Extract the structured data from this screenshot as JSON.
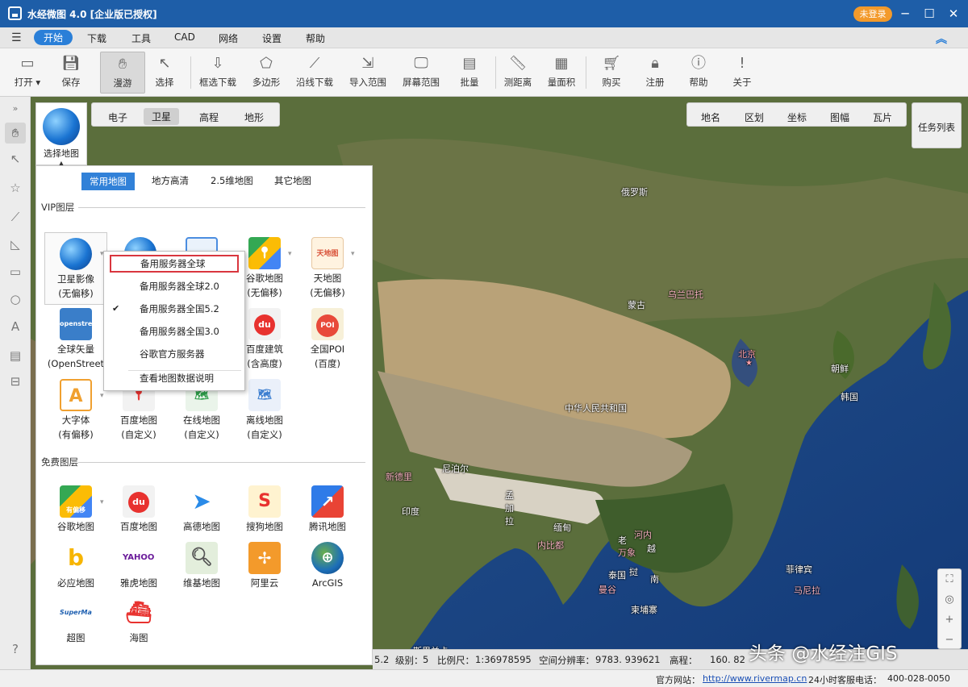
{
  "app": {
    "title": "水经微图 4.0 [企业版已授权]",
    "login": "未登录"
  },
  "menu": [
    "开始",
    "下载",
    "工具",
    "CAD",
    "网络",
    "设置",
    "帮助"
  ],
  "toolbar": [
    {
      "label": "打开 ▾",
      "icon": "folder-icon"
    },
    {
      "label": "保存",
      "icon": "save-icon"
    },
    {
      "label": "漫游",
      "icon": "hand-icon"
    },
    {
      "label": "选择",
      "icon": "cursor-icon"
    },
    {
      "label": "框选下载",
      "icon": "box-download-icon"
    },
    {
      "label": "多边形",
      "icon": "polygon-download-icon"
    },
    {
      "label": "沿线下载",
      "icon": "line-download-icon"
    },
    {
      "label": "导入范围",
      "icon": "import-icon"
    },
    {
      "label": "屏幕范围",
      "icon": "screen-icon"
    },
    {
      "label": "批量",
      "icon": "batch-icon"
    },
    {
      "label": "测距离",
      "icon": "ruler-icon"
    },
    {
      "label": "量面积",
      "icon": "area-icon"
    },
    {
      "label": "购买",
      "icon": "cart-icon"
    },
    {
      "label": "注册",
      "icon": "lock-icon"
    },
    {
      "label": "帮助",
      "icon": "help-icon"
    },
    {
      "label": "关于",
      "icon": "info-icon"
    }
  ],
  "map_type_tabs": [
    "电子",
    "卫星",
    "高程",
    "地形"
  ],
  "overlay_tabs": [
    "地名",
    "区划",
    "坐标",
    "图幅",
    "瓦片"
  ],
  "task_list": "任务列表",
  "select_map": "选择地图",
  "panel": {
    "tabs": [
      "常用地图",
      "地方高清",
      "2.5维地图",
      "其它地图"
    ],
    "vip_section": "VIP图层",
    "free_section": "免费图层",
    "vip_items": [
      {
        "line1": "卫星影像",
        "line2": "(无偏移)"
      },
      {
        "line1": "谷歌地图",
        "line2": "(无偏移)"
      },
      {
        "line1": "天地图",
        "line2": "(无偏移)"
      },
      {
        "line1": "全球矢量",
        "line2": "(OpenStreet"
      },
      {
        "line1": "百度建筑",
        "line2": "(含高度)"
      },
      {
        "line1": "全国POI",
        "line2": "(百度)"
      },
      {
        "line1": "大字体",
        "line2": "(有偏移)"
      },
      {
        "line1": "百度地图",
        "line2": "(自定义)"
      },
      {
        "line1": "在线地图",
        "line2": "(自定义)"
      },
      {
        "line1": "离线地图",
        "line2": "(自定义)"
      }
    ],
    "free_items": [
      "谷歌地图",
      "百度地图",
      "高德地图",
      "搜狗地图",
      "腾讯地图",
      "必应地图",
      "雅虎地图",
      "维基地图",
      "阿里云",
      "ArcGIS",
      "超图",
      "海图"
    ],
    "icon_text": {
      "openstreet": "openstreet",
      "du": "du",
      "poi": "POI",
      "tianditu": "天地图",
      "yahoo": "YAHOO!",
      "supermap": "SuperMap",
      "youpianyi": "有偏移"
    }
  },
  "dropdown": {
    "items": [
      "备用服务器全球",
      "备用服务器全球2.0",
      "备用服务器全国5.2",
      "备用服务器全国3.0",
      "谷歌官方服务器",
      "查看地图数据说明"
    ],
    "checked_index": 2
  },
  "map_labels": [
    "俄罗斯",
    "乌兰巴托",
    "蒙古",
    "北京",
    "朝鲜",
    "韩国",
    "中华人民共和国",
    "尼泊尔",
    "新德里",
    "孟",
    "加",
    "拉",
    "印度",
    "缅甸",
    "内比都",
    "老",
    "挝",
    "万象",
    "越",
    "南",
    "河内",
    "泰国",
    "曼谷",
    "柬埔寨",
    "菲律宾",
    "马尼拉",
    "斯里兰卡"
  ],
  "status": {
    "coords": "5.2",
    "level_label": "级别：",
    "level": "5",
    "scale_label": "比例尺：",
    "scale": "1:36978595",
    "resolution_label": "空间分辨率：",
    "resolution": "9783. 939621",
    "elevation_label": "高程：",
    "elevation": "160. 82"
  },
  "footer": {
    "site_label": "官方网站：",
    "site": "http://www.rivermap.cn",
    "phone_label": "24小时客服电话：",
    "phone": "400-028-0050"
  },
  "watermark": "头条 @水经注GIS"
}
